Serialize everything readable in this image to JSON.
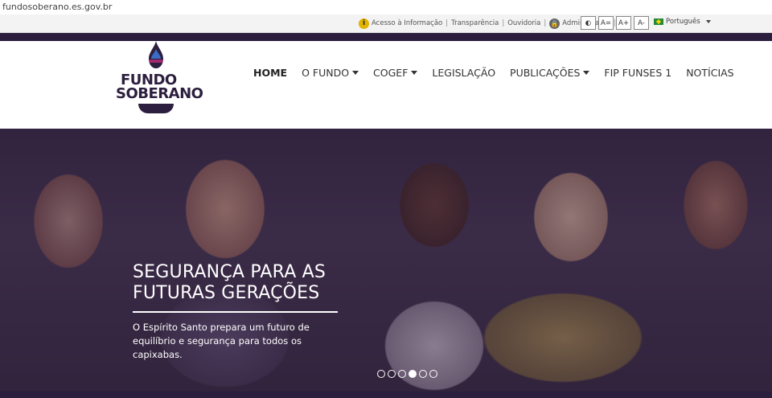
{
  "browser": {
    "url": "fundosoberano.es.gov.br"
  },
  "utility": {
    "links": [
      "Acesso à Informação",
      "Transparência",
      "Ouvidoria"
    ],
    "admin": "Administrador",
    "a11y": {
      "contrast": "◐",
      "increase": "A+",
      "normal": "A=",
      "decrease": "A-"
    },
    "language": "Português"
  },
  "logo": {
    "line1": "FUNDO",
    "line2": "SOBERANO"
  },
  "nav": {
    "items": [
      {
        "label": "HOME",
        "dropdown": false
      },
      {
        "label": "O FUNDO",
        "dropdown": true
      },
      {
        "label": "COGEF",
        "dropdown": true
      },
      {
        "label": "LEGISLAÇÃO",
        "dropdown": false
      },
      {
        "label": "PUBLICAÇÕES",
        "dropdown": true
      },
      {
        "label": "FIP FUNSES 1",
        "dropdown": false
      },
      {
        "label": "NOTÍCIAS",
        "dropdown": false
      }
    ]
  },
  "hero": {
    "title_line1": "SEGURANÇA PARA AS",
    "title_line2": "FUTURAS GERAÇÕES",
    "text": "O Espírito Santo prepara um futuro de equilíbrio e segurança para todos os capixabas.",
    "slides_total": 6,
    "active_slide": 4
  },
  "colors": {
    "brand": "#2c1e3e",
    "accent_magenta": "#a0286e",
    "accent_blue": "#3b6cc4"
  }
}
